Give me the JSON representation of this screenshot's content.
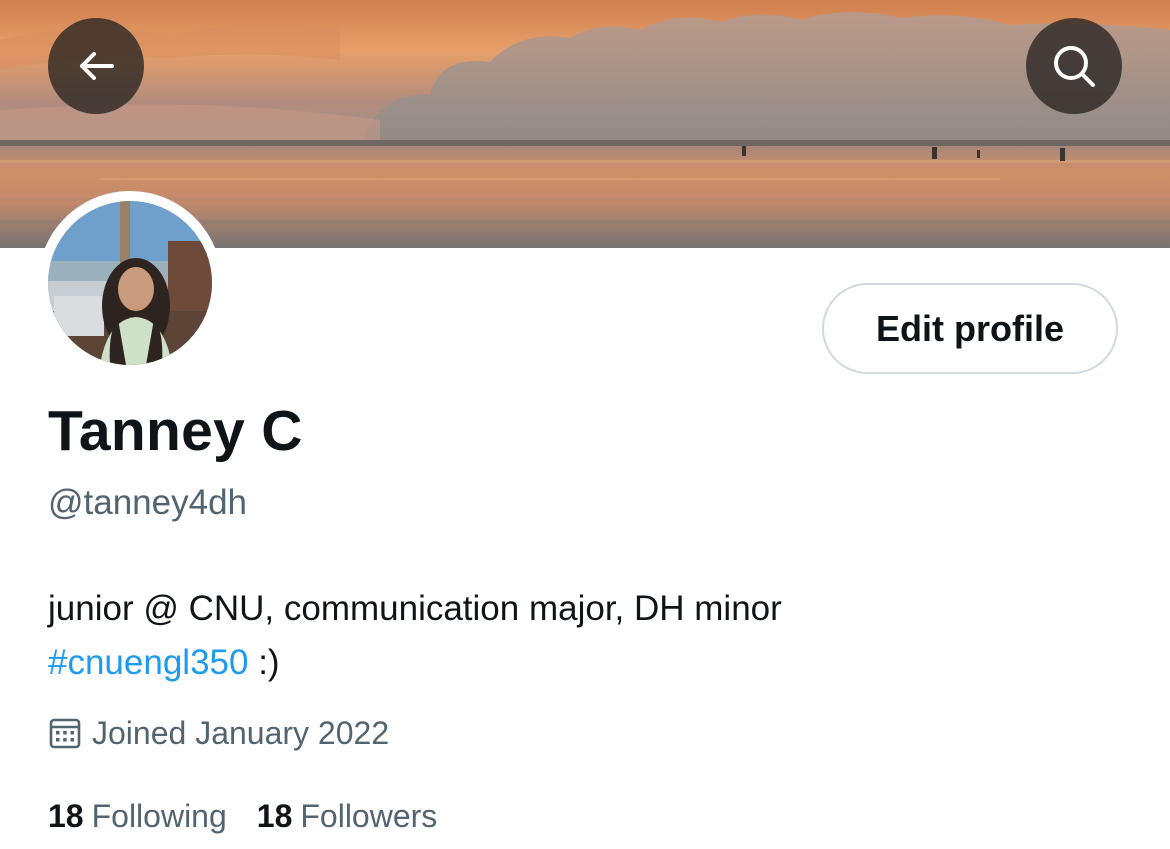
{
  "header": {
    "back_icon": "arrow-left-icon",
    "search_icon": "search-icon"
  },
  "profile": {
    "display_name": "Tanney C",
    "handle": "@tanney4dh",
    "edit_button_label": "Edit profile",
    "bio": {
      "line1": "junior @ CNU, communication major, DH minor",
      "hashtag": "#cnuengl350",
      "line2_suffix": " :)"
    },
    "joined": {
      "icon": "calendar-icon",
      "text": "Joined January 2022"
    },
    "following": {
      "count": "18",
      "label": "Following"
    },
    "followers": {
      "count": "18",
      "label": "Followers"
    }
  },
  "colors": {
    "accent": "#1d9bf0",
    "primary_text": "#0f1419",
    "secondary_text": "#536471",
    "button_border": "#cfd9de"
  }
}
